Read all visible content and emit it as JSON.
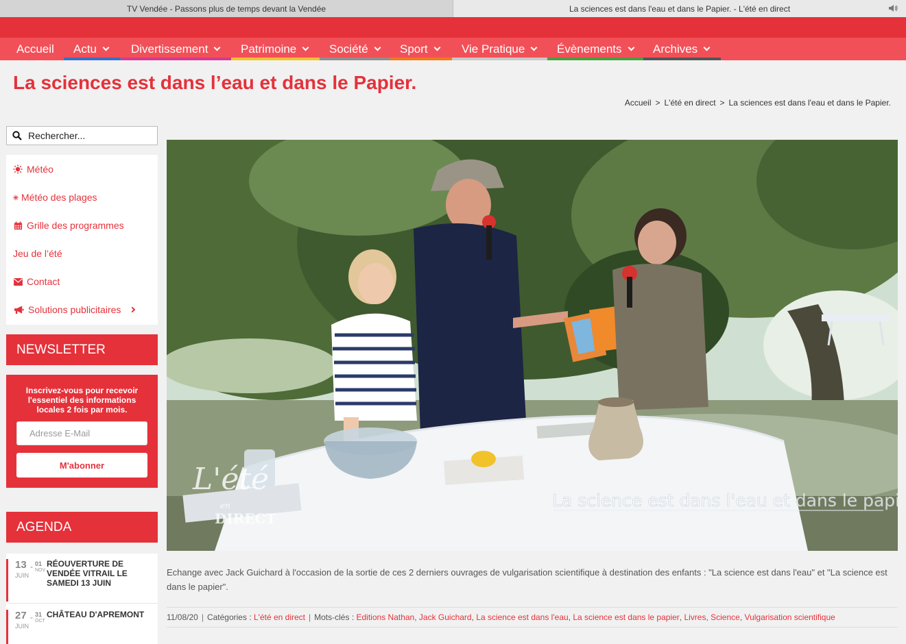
{
  "browser": {
    "tabs": [
      {
        "title": "TV Vendée - Passons plus de temps devant la Vendée"
      },
      {
        "title": "La sciences est dans l'eau et dans le Papier. - L'été en direct"
      }
    ]
  },
  "nav": {
    "items": [
      {
        "label": "Accueil",
        "color": ""
      },
      {
        "label": "Actu",
        "color": "#3a6fc4"
      },
      {
        "label": "Divertissement",
        "color": "#d33a8f"
      },
      {
        "label": "Patrimoine",
        "color": "#f0c230"
      },
      {
        "label": "Société",
        "color": "#8e8e8e"
      },
      {
        "label": "Sport",
        "color": "#f07a1a"
      },
      {
        "label": "Vie Pratique",
        "color": "#c8c8c8"
      },
      {
        "label": "Évènements",
        "color": "#4a9e3f"
      },
      {
        "label": "Archives",
        "color": "#555555"
      }
    ]
  },
  "page": {
    "title": "La sciences est dans l’eau et dans le Papier."
  },
  "breadcrumb": {
    "items": [
      "Accueil",
      "L'été en direct",
      "La sciences est dans l'eau et dans le Papier."
    ],
    "separator": ">"
  },
  "sidebar": {
    "search_placeholder": "Rechercher...",
    "menu": [
      {
        "label": "Météo",
        "icon": "sun-icon"
      },
      {
        "label": "Météo des plages",
        "icon": "snowflake-icon"
      },
      {
        "label": "Grille des programmes",
        "icon": "calendar-icon"
      },
      {
        "label": "Jeu de l’été",
        "icon": ""
      },
      {
        "label": "Contact",
        "icon": "envelope-icon"
      },
      {
        "label": "Solutions publicitaires",
        "icon": "megaphone-icon"
      }
    ],
    "newsletter": {
      "heading": "NEWSLETTER",
      "intro": "Inscrivez-vous pour recevoir l'essentiel des informations locales 2 fois par mois.",
      "email_placeholder": "Adresse E-Mail",
      "button": "M'abonner"
    },
    "agenda": {
      "heading": "AGENDA",
      "events": [
        {
          "day1": "13",
          "month1": "JUIN",
          "day2": "01",
          "month2": "NOV",
          "title": "RÉOUVERTURE DE VENDÉE VITRAIL LE SAMEDI 13 JUIN"
        },
        {
          "day1": "27",
          "month1": "JUIN",
          "day2": "31",
          "month2": "OCT",
          "title": "CHÂTEAU D'APREMONT"
        }
      ]
    }
  },
  "video": {
    "overlay_text": "La science est dans l'eau et dans le papier",
    "logo_line1": "L'été",
    "logo_line2": "en",
    "logo_line3": "DIRECT"
  },
  "article": {
    "caption": "Echange avec Jack Guichard à l'occasion de la sortie de ces 2 derniers ouvrages de vulgarisation scientifique à destination des enfants : \"La science est dans l'eau\" et \"La science est dans le papier\".",
    "date": "11/08/20",
    "categories_label": "Catégories :",
    "categories": [
      "L'été en direct"
    ],
    "tags_label": "Mots-clés :",
    "tags": [
      "Editions Nathan",
      "Jack Guichard",
      "La science est dans l'eau",
      "La science est dans le papier",
      "Livres",
      "Science",
      "Vulgarisation scientifique"
    ]
  },
  "colors": {
    "brand_red": "#e5313a",
    "nav_red": "#f25058"
  }
}
